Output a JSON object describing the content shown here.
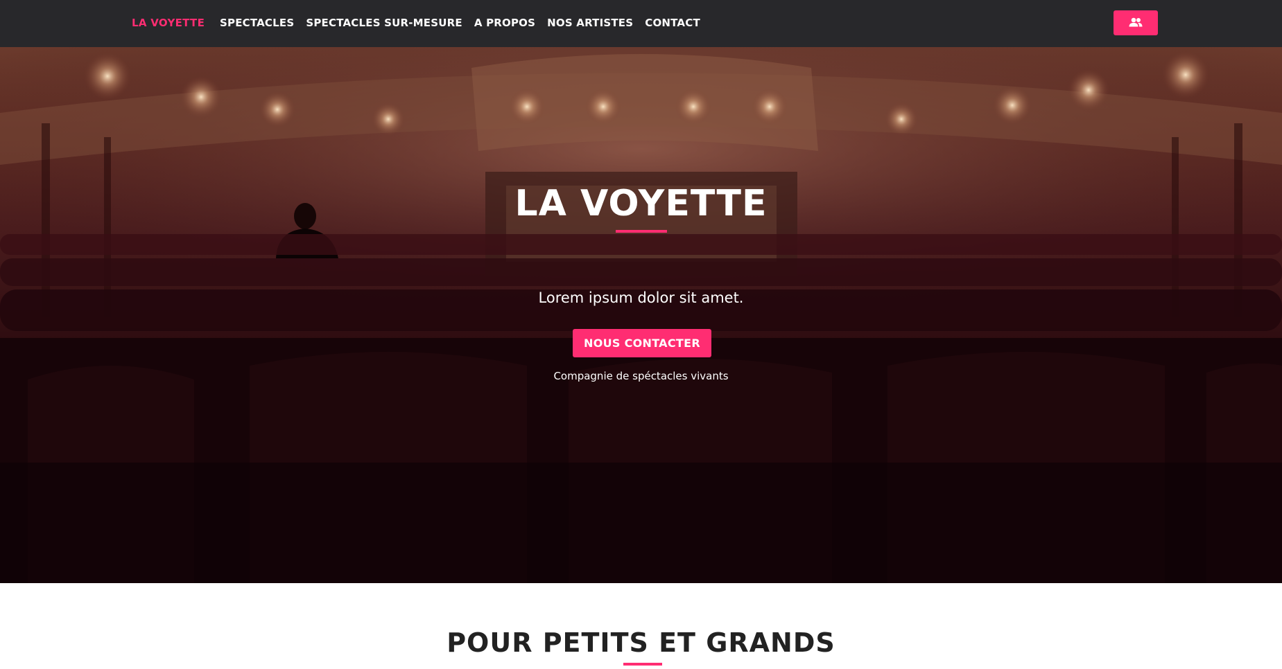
{
  "nav": {
    "brand": "LA VOYETTE",
    "links": [
      {
        "label": "SPECTACLES"
      },
      {
        "label": "SPECTACLES SUR-MESURE"
      },
      {
        "label": "A PROPOS"
      },
      {
        "label": "NOS ARTISTES"
      },
      {
        "label": "CONTACT"
      }
    ],
    "account_icon": "users-icon"
  },
  "hero": {
    "title": "LA VOYETTE",
    "subtitle": "Lorem ipsum dolor sit amet.",
    "cta_label": "NOUS CONTACTER",
    "tagline": "Compagnie de spéctacles vivants",
    "background": "theater-auditorium-photo"
  },
  "section": {
    "title": "POUR PETITS ET GRANDS"
  },
  "colors": {
    "accent": "#ff2d72",
    "navbar": "#28282b",
    "hero_tint": "#3a1216"
  }
}
